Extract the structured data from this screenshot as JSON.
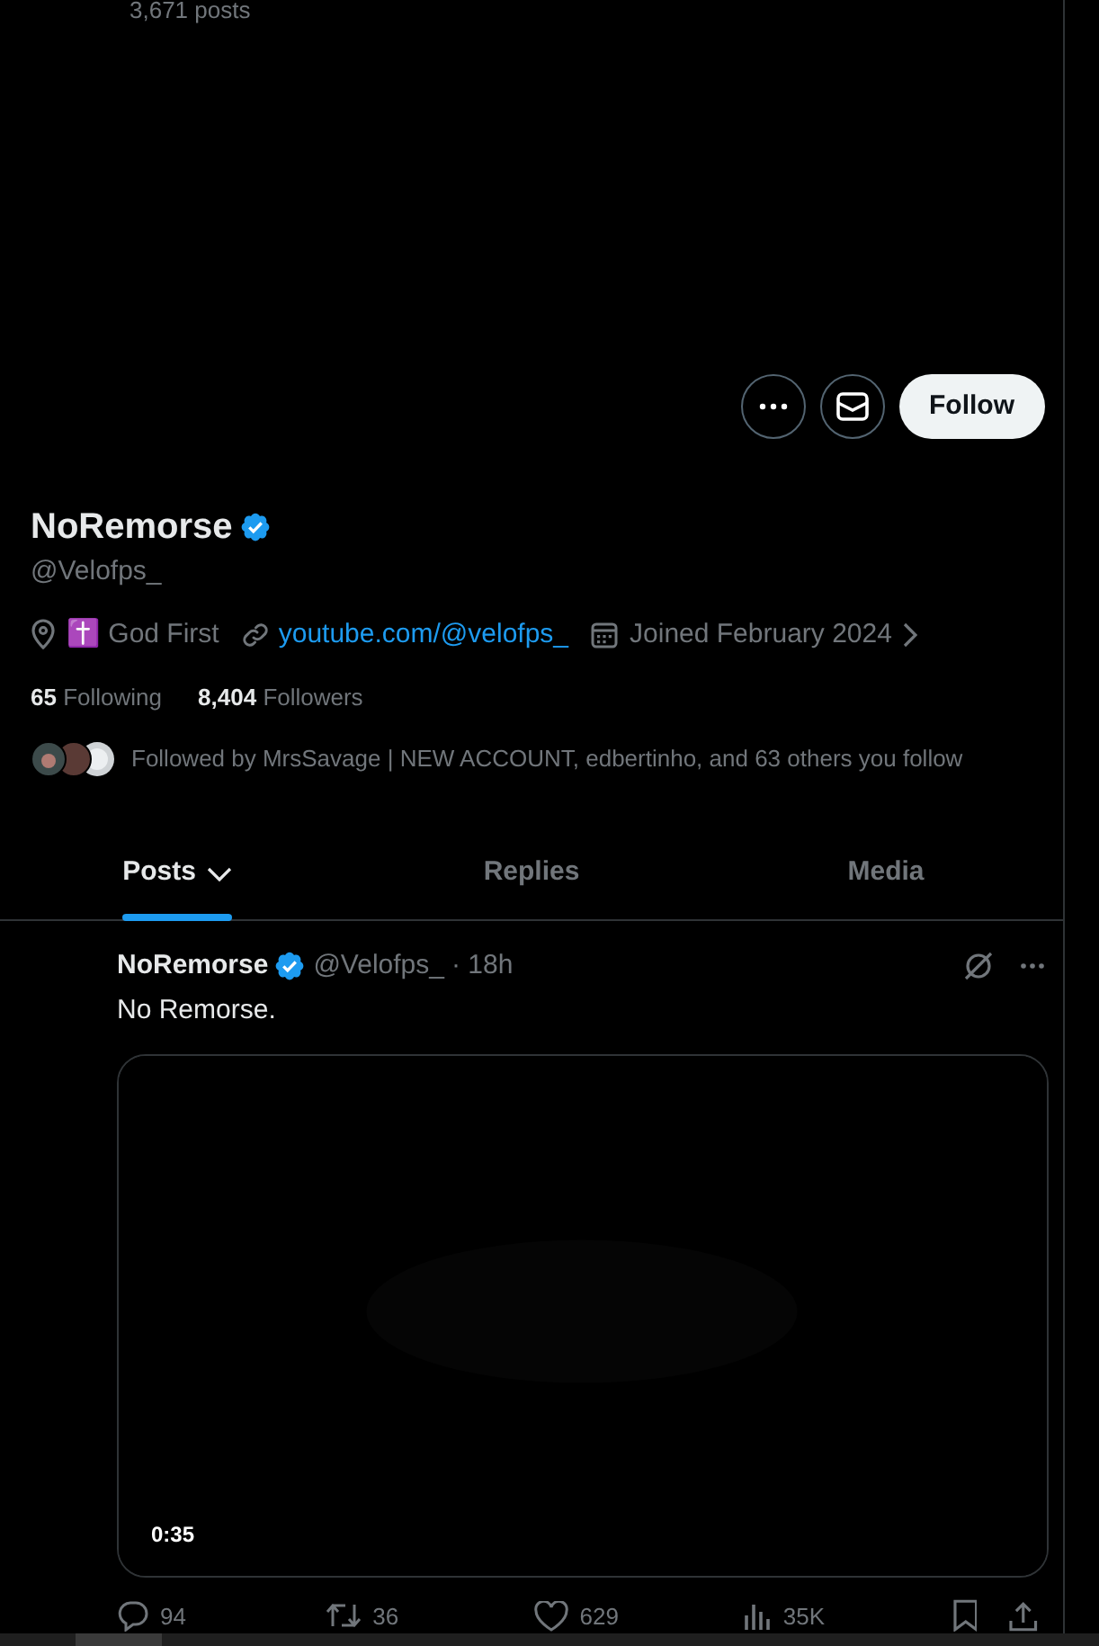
{
  "header": {
    "post_count": "3,671 posts"
  },
  "actions": {
    "follow_button": "Follow"
  },
  "profile": {
    "name": "NoRemorse",
    "verified": true,
    "handle": "@Velofps_",
    "location": "✝️ God First",
    "link": "youtube.com/@velofps_",
    "joined": "Joined February 2024",
    "following_count": "65",
    "following_label": "Following",
    "followers_count": "8,404",
    "followers_label": "Followers",
    "followed_by": "Followed by MrsSavage | NEW ACCOUNT, edbertinho, and 63 others you follow"
  },
  "tabs": [
    {
      "label": "Posts",
      "selected": true,
      "has_menu": true
    },
    {
      "label": "Replies",
      "selected": false,
      "has_menu": false
    },
    {
      "label": "Media",
      "selected": false,
      "has_menu": false
    }
  ],
  "post": {
    "author": "NoRemorse",
    "verified": true,
    "handle": "@Velofps_",
    "time": "· 18h",
    "text": "No Remorse.",
    "media": {
      "kind": "picture",
      "duration": "0:35"
    },
    "stats": [
      {
        "kind": "reply",
        "count": "94"
      },
      {
        "kind": "repost",
        "count": "36"
      },
      {
        "kind": "like",
        "count": "629"
      },
      {
        "kind": "views",
        "count": "35K"
      }
    ]
  }
}
